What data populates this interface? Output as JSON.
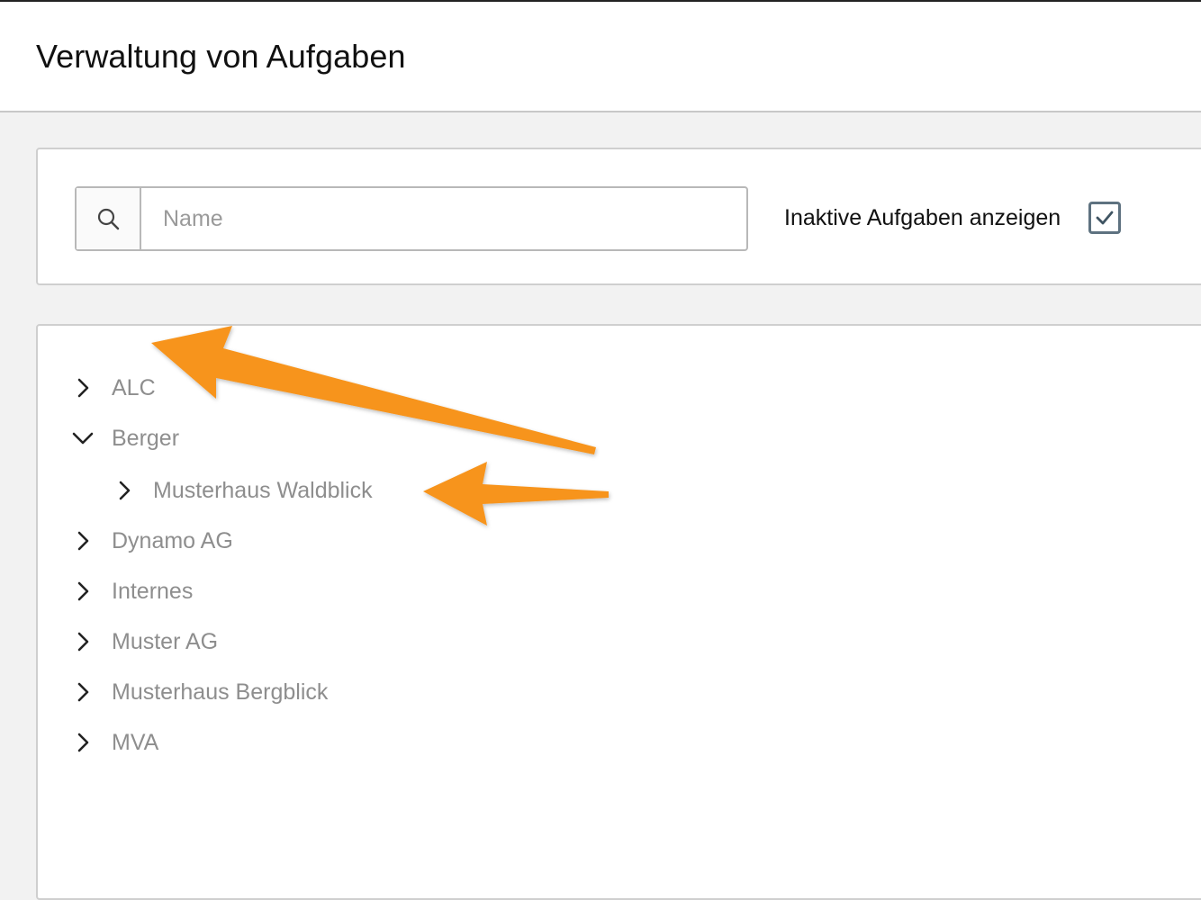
{
  "header": {
    "title": "Verwaltung von Aufgaben"
  },
  "filter": {
    "search_placeholder": "Name",
    "search_value": "",
    "inactive_label": "Inaktive Aufgaben anzeigen",
    "inactive_checked": true
  },
  "tree": {
    "items": [
      {
        "label": "ALC",
        "expanded": false,
        "level": 0
      },
      {
        "label": "Berger",
        "expanded": true,
        "level": 0
      },
      {
        "label": "Musterhaus Waldblick",
        "expanded": false,
        "level": 1
      },
      {
        "label": "Dynamo AG",
        "expanded": false,
        "level": 0
      },
      {
        "label": "Internes",
        "expanded": false,
        "level": 0
      },
      {
        "label": "Muster AG",
        "expanded": false,
        "level": 0
      },
      {
        "label": "Musterhaus Bergblick",
        "expanded": false,
        "level": 0
      },
      {
        "label": "MVA",
        "expanded": false,
        "level": 0
      }
    ]
  },
  "icons": {
    "search": "search-icon",
    "checkbox": "check-icon",
    "collapsed": "chevron-right-icon",
    "expanded": "chevron-down-icon"
  },
  "colors": {
    "annotation_arrow": "#f7941d",
    "checkbox_border": "#5e7280",
    "tree_text": "#8e8e8e"
  }
}
